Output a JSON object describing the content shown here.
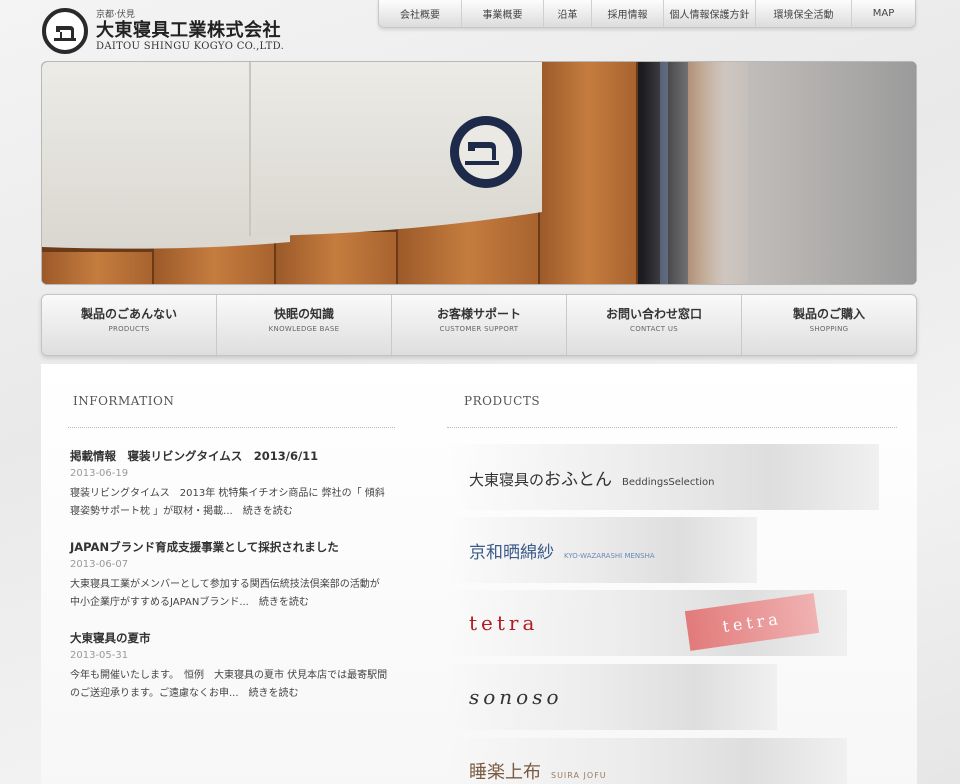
{
  "header": {
    "region": "京都·伏見",
    "company_name": "大東寝具工業株式会社",
    "company_name_en": "DAITOU SHINGU KOGYO CO.,LTD."
  },
  "top_nav": [
    {
      "label": "会社概要"
    },
    {
      "label": "事業概要"
    },
    {
      "label": "沿革"
    },
    {
      "label": "採用情報"
    },
    {
      "label": "個人情報保護方針"
    },
    {
      "label": "環境保全活動"
    },
    {
      "label": "MAP"
    }
  ],
  "main_nav": [
    {
      "label": "製品のごあんない",
      "sub": "PRODUCTS"
    },
    {
      "label": "快眠の知識",
      "sub": "KNOWLEDGE BASE"
    },
    {
      "label": "お客様サポート",
      "sub": "CUSTOMER SUPPORT"
    },
    {
      "label": "お問い合わせ窓口",
      "sub": "CONTACT US"
    },
    {
      "label": "製品のご購入",
      "sub": "SHOPPING"
    }
  ],
  "information": {
    "heading": "INFORMATION",
    "items": [
      {
        "title": "掲載情報　寝装リビングタイムス　2013/6/11",
        "date": "2013-06-19",
        "body": "寝装リビングタイムス　2013年 枕特集イチオシ商品に 弊社の「 傾斜寝姿勢サポート枕 」が取材・掲載...",
        "more": "続きを読む"
      },
      {
        "title": "JAPANブランド育成支援事業として採択されました",
        "date": "2013-06-07",
        "body": "大東寝具工業がメンバーとして参加する関西伝統技法倶楽部の活動が 中小企業庁がすすめるJAPANブランド...",
        "more": "続きを読む"
      },
      {
        "title": "大東寝具の夏市",
        "date": "2013-05-31",
        "body": "今年も開催いたします。　恒例　大東寝具の夏市 伏見本店では最寄駅間のご送迎承ります。ご遠慮なくお申...",
        "more": "続きを読む"
      }
    ]
  },
  "products": {
    "heading": "PRODUCTS",
    "items": [
      {
        "name_pre": "大東寝具の",
        "name_main": "おふとん",
        "sub": "BeddingsSelection"
      },
      {
        "name_main": "京和晒綿紗",
        "sub": "KYO-WAZARASHI MENSHA"
      },
      {
        "name_main": "tetra",
        "card": "tetra"
      },
      {
        "name_main": "sonoso"
      },
      {
        "name_main": "睡楽上布",
        "sub": "SUIRA JOFU"
      }
    ]
  },
  "colors": {
    "accent_red": "#b01c22",
    "kyowa_blue": "#3a5a8a",
    "noren_navy": "#1e2a4a"
  }
}
